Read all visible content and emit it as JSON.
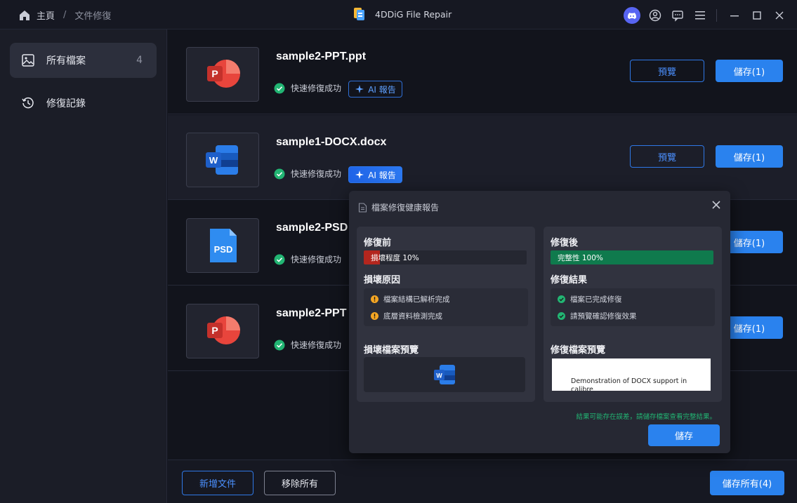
{
  "titlebar": {
    "home_label": "主頁",
    "separator": "/",
    "current": "文件修復",
    "app_title": "4DDiG File Repair"
  },
  "sidebar": {
    "items": [
      {
        "label": "所有檔案",
        "count": "4"
      },
      {
        "label": "修復記錄"
      }
    ]
  },
  "files": [
    {
      "name": "sample2-PPT.ppt",
      "type": "ppt",
      "status": "快速修復成功",
      "ai_label": "AI 報告",
      "preview_label": "預覽",
      "save_label": "儲存(1)"
    },
    {
      "name": "sample1-DOCX.docx",
      "type": "docx",
      "status": "快速修復成功",
      "ai_label": "AI 報告",
      "preview_label": "預覽",
      "save_label": "儲存(1)"
    },
    {
      "name": "sample2-PSD",
      "type": "psd",
      "status": "快速修復成功",
      "save_label": "儲存(1)",
      "icon_text": "PSD"
    },
    {
      "name": "sample2-PPT",
      "type": "ppt",
      "status": "快速修復成功",
      "save_label": "儲存(1)"
    }
  ],
  "bottombar": {
    "add_label": "新增文件",
    "remove_label": "移除所有",
    "save_all_label": "儲存所有(4)"
  },
  "report": {
    "title": "檔案修復健康報告",
    "before": {
      "heading": "修復前",
      "bar_label": "損壞程度 10%",
      "bar_value": 0.1,
      "cause_heading": "損壞原因",
      "causes": [
        "檔案結構已解析完成",
        "底層資料檢測完成"
      ],
      "preview_heading": "損壞檔案預覽"
    },
    "after": {
      "heading": "修復後",
      "bar_label": "完整性 100%",
      "bar_value": 1.0,
      "result_heading": "修復結果",
      "results": [
        "檔案已完成修復",
        "請預覽確認修復效果"
      ],
      "preview_heading": "修復檔案預覽",
      "preview_text": "Demonstration of DOCX support in calibre"
    },
    "note": "結果可能存在誤差，請儲存檔案查看完整結果。",
    "save_label": "儲存"
  },
  "colors": {
    "accent": "#2a82ee",
    "damage": "#b3261e",
    "integrity": "#0f7a4d",
    "success": "#22b573",
    "warning": "#f5a623"
  }
}
